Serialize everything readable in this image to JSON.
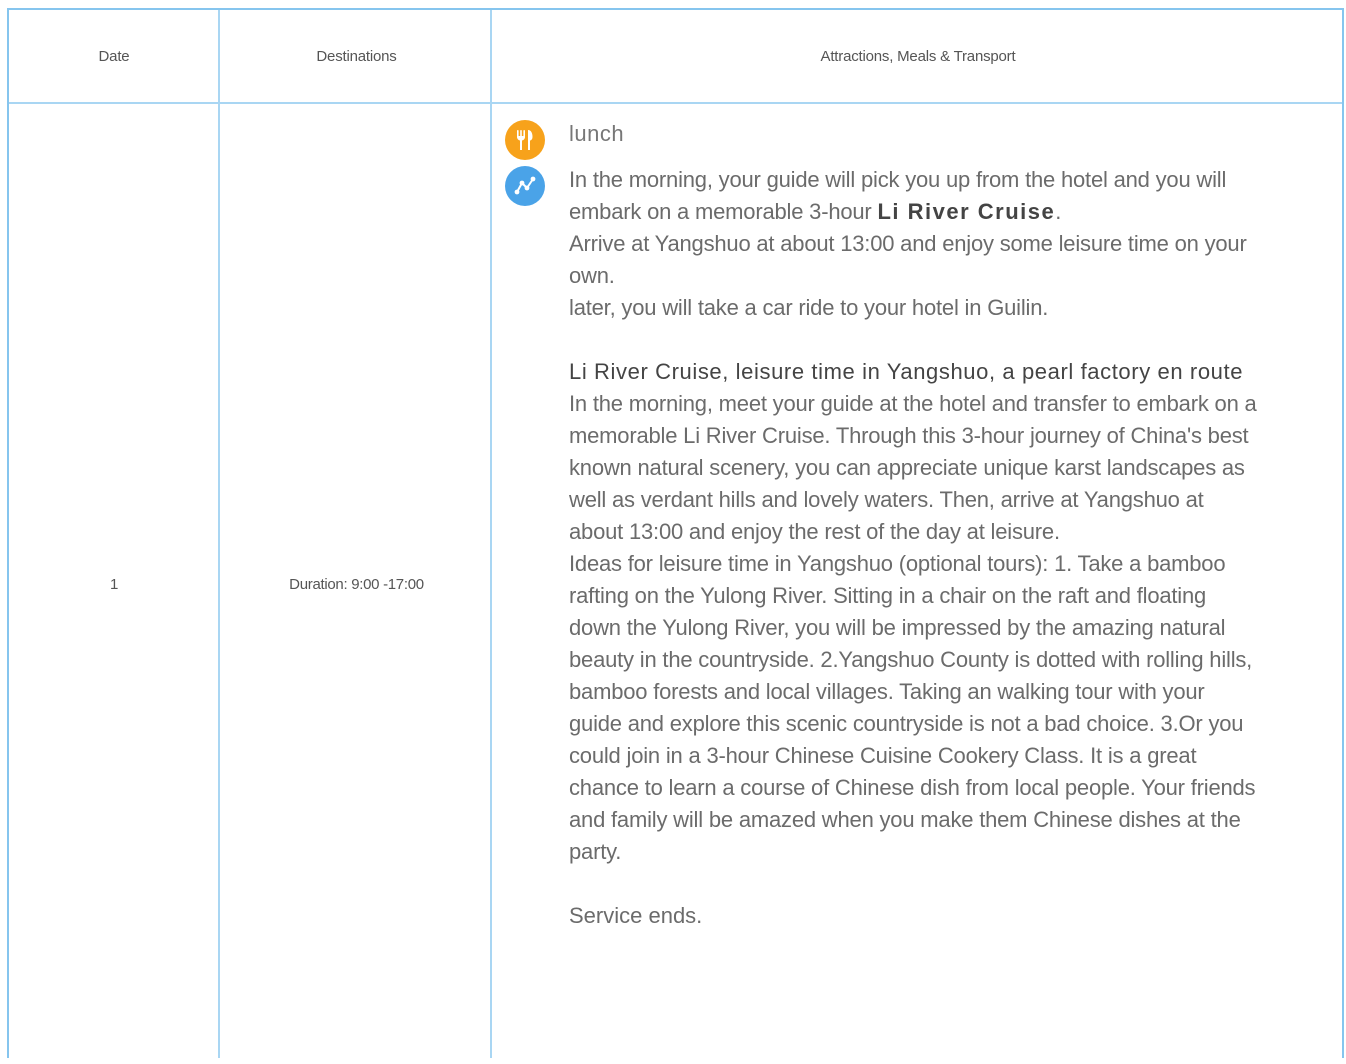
{
  "table": {
    "headers": {
      "date": "Date",
      "destinations": "Destinations",
      "attractions": "Attractions, Meals & Transport"
    },
    "rows": [
      {
        "day": "1",
        "destination": "Duration: 9:00 -17:00",
        "meal": {
          "icon": "fork-knife-icon",
          "icon_color": "#f7a21b",
          "label": "lunch"
        },
        "route": {
          "icon": "route-icon",
          "icon_color": "#4aa3e8",
          "line1_pre": "In the morning, your guide will pick you up from the hotel and you will embark on a memorable 3-hour ",
          "line1_bold": "Li River Cruise",
          "line1_post": ".",
          "line2": "Arrive at Yangshuo at about 13:00 and enjoy some leisure time on your own.",
          "line3": "later, you will take a car ride to your hotel in Guilin."
        },
        "subheading": "Li River Cruise, leisure time in Yangshuo, a pearl factory en route",
        "description": "In the morning, meet your guide at the hotel and transfer to embark on a memorable Li River Cruise. Through this 3-hour journey of China's best known natural scenery, you can appreciate unique karst landscapes as well as verdant hills and lovely waters. Then, arrive at Yangshuo at about 13:00 and enjoy the rest of the day at leisure.",
        "ideas": "Ideas for leisure time in Yangshuo (optional tours): 1. Take a bamboo rafting on the Yulong River. Sitting in a chair on the raft and floating down the Yulong River, you will be impressed by the amazing natural beauty in the countryside. 2.Yangshuo County is dotted with rolling hills, bamboo forests and local villages. Taking an walking tour with your guide and explore this scenic countryside is not a bad choice. 3.Or you could join in a 3-hour Chinese Cuisine Cookery Class. It is a great chance to learn a course of Chinese dish from local people. Your friends and family will be amazed when you make them Chinese dishes at the party.",
        "service_end": "Service ends."
      }
    ]
  },
  "colors": {
    "border": "#86c5ee",
    "grid": "#a9d6f3"
  }
}
